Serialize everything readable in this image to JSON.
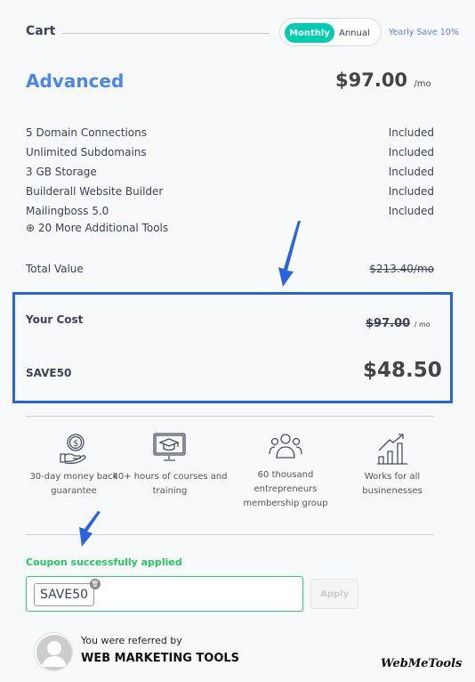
{
  "header": {
    "title": "Cart",
    "billing": {
      "monthly": "Monthly",
      "annual": "Annual",
      "selected": "Monthly"
    },
    "yearly_note": "Yearly Save 10%"
  },
  "plan": {
    "name": "Advanced",
    "price": "$97.00",
    "unit": "/mo"
  },
  "features": [
    {
      "name": "5 Domain Connections",
      "status": "Included"
    },
    {
      "name": "Unlimited Subdomains",
      "status": "Included"
    },
    {
      "name": "3 GB Storage",
      "status": "Included"
    },
    {
      "name": "Builderall Website Builder",
      "status": "Included"
    },
    {
      "name": "Mailingboss 5.0",
      "status": "Included"
    }
  ],
  "more_tools": "⊕ 20 More Additional Tools",
  "total": {
    "label": "Total Value",
    "value": "$213.40/mo"
  },
  "cost": {
    "label": "Your Cost",
    "original": "$97.00",
    "unit": "/ mo",
    "code": "SAVE50",
    "final": "$48.50"
  },
  "benefits": [
    {
      "icon": "money-hand-icon",
      "text": "30-day money back guarantee"
    },
    {
      "icon": "monitor-graduation-icon",
      "text": "40+ hours of courses and training"
    },
    {
      "icon": "people-group-icon",
      "text": "60 thousand entrepreneurs membership group"
    },
    {
      "icon": "growth-chart-icon",
      "text": "Works for all businenesses"
    }
  ],
  "coupon": {
    "message": "Coupon successfully applied",
    "code": "SAVE50",
    "apply": "Apply"
  },
  "referral": {
    "label": "You were referred by",
    "name": "WEB MARKETING TOOLS"
  },
  "watermark": "WebMeTools",
  "colors": {
    "accent": "#00cdb0",
    "plan": "#4a86f0",
    "highlight": "#2664dd",
    "success": "#1ecb5c"
  }
}
